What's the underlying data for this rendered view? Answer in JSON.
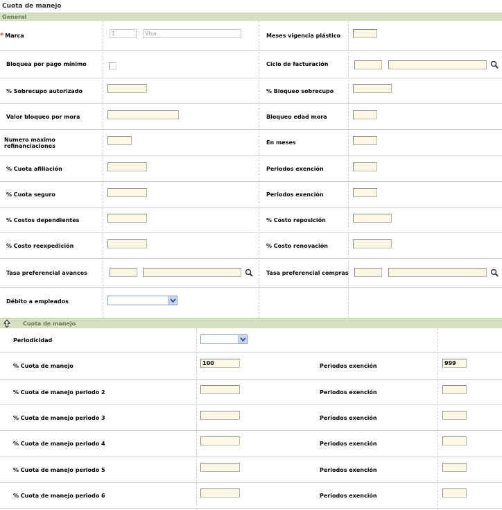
{
  "page_title": "Cuota de manejo",
  "section_general": "General",
  "general_rows": [
    {
      "left_label": "Marca",
      "required": true,
      "right_label": "Meses vigencia plástico"
    },
    {
      "left_label": "Bloquea por pago mínimo",
      "right_label": "Ciclo de facturación"
    },
    {
      "left_label": "% Sobrecupo autorizado",
      "right_label": "% Bloqueo sobrecupo"
    },
    {
      "left_label": "Valor bloqueo por mora",
      "right_label": "Bloqueo edad mora"
    },
    {
      "left_label": "Numero maximo refinanciaciones",
      "right_label": "En meses"
    },
    {
      "left_label": "% Cuota afiliación",
      "right_label": "Periodos exención"
    },
    {
      "left_label": "% Cuota seguro",
      "right_label": "Periodos exención"
    },
    {
      "left_label": "% Costos dependientes",
      "right_label": "% Costo reposición"
    },
    {
      "left_label": "% Costo reexpedición",
      "right_label": "% Costo renovación"
    },
    {
      "left_label": "Tasa preferencial avances",
      "right_label": "Tasa preferencial compras"
    },
    {
      "left_label": "Débito a empleados",
      "right_label": ""
    }
  ],
  "marca": {
    "code": "1",
    "name": "Visa"
  },
  "subsection": {
    "title": "Cuota de manejo",
    "periodicidad_label": "Periodicidad",
    "rows": [
      {
        "label": "% Cuota de manejo",
        "value": "100",
        "right_label": "Periodos exención",
        "right_value": "999"
      },
      {
        "label": "% Cuota de manejo periodo 2",
        "value": "",
        "right_label": "Periodos exención",
        "right_value": ""
      },
      {
        "label": "% Cuota de manejo periodo 3",
        "value": "",
        "right_label": "Periodos exención",
        "right_value": ""
      },
      {
        "label": "% Cuota de manejo periodo 4",
        "value": "",
        "right_label": "Periodos exención",
        "right_value": ""
      },
      {
        "label": "% Cuota de manejo periodo 5",
        "value": "",
        "right_label": "Periodos exención",
        "right_value": ""
      },
      {
        "label": "% Cuota de manejo periodo 6",
        "value": "",
        "right_label": "Periodos exención",
        "right_value": ""
      }
    ]
  },
  "icons": {
    "search": "magnifier-icon",
    "collapse": "arrow-up-icon",
    "dropdown": "chevron-down-icon"
  },
  "colors": {
    "section_bg": "#d6dfc0",
    "input_bg": "#fdf8e6",
    "required": "#e05020"
  }
}
